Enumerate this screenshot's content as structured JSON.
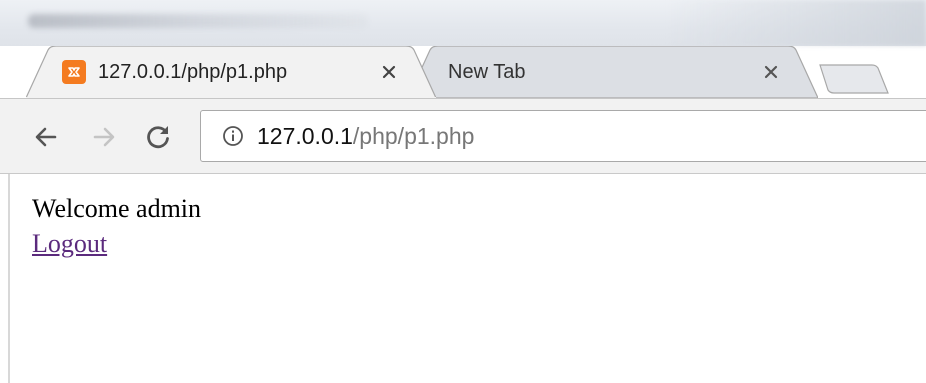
{
  "tabs": [
    {
      "title": "127.0.0.1/php/p1.php",
      "favicon": "xampp-icon",
      "active": true
    },
    {
      "title": "New Tab",
      "active": false
    }
  ],
  "toolbar": {
    "back_icon": "arrow-left-icon",
    "forward_icon": "arrow-right-icon",
    "reload_icon": "reload-icon"
  },
  "address": {
    "info_icon": "info-icon",
    "host": "127.0.0.1",
    "path": "/php/p1.php"
  },
  "page": {
    "welcome_text": "Welcome admin",
    "logout_link": "Logout"
  },
  "colors": {
    "favicon": "#f47b20",
    "visited_link": "#5b2a7d",
    "toolbar_bg": "#f2f2f2"
  }
}
